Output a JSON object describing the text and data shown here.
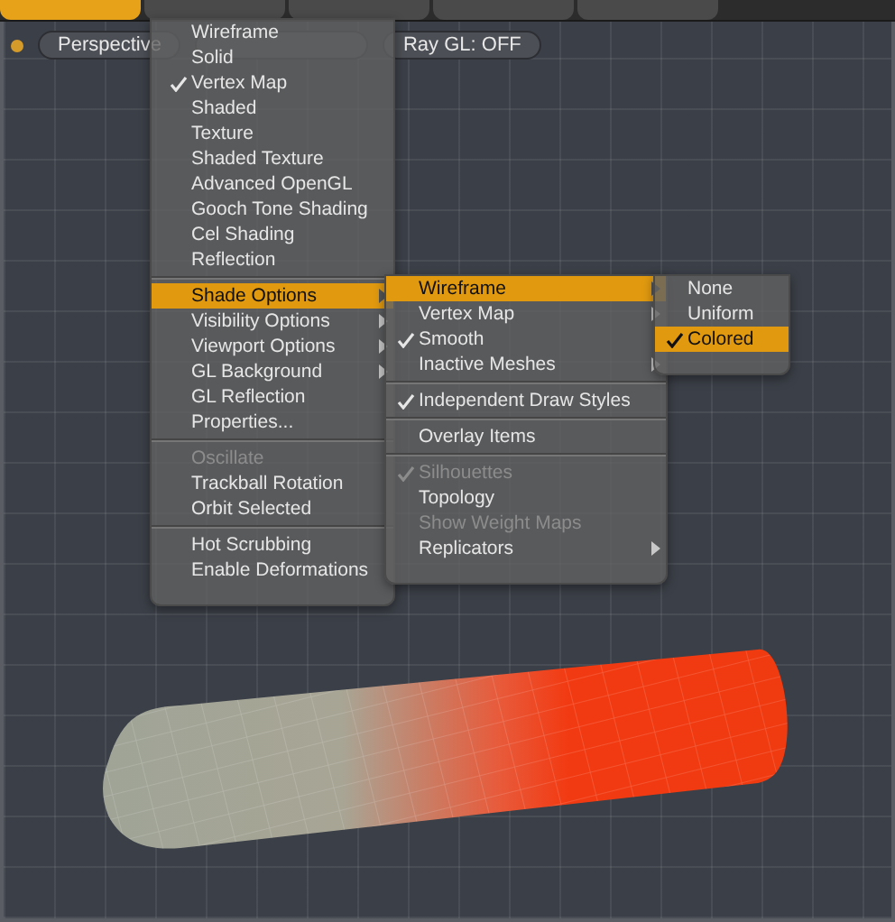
{
  "top_tabs": [
    {
      "selected": true
    },
    {
      "selected": false
    },
    {
      "selected": false
    },
    {
      "selected": false
    },
    {
      "selected": false
    }
  ],
  "viewport_bar": {
    "items": [
      {
        "label": "Perspective"
      },
      {
        "label": "Ray GL: OFF"
      }
    ]
  },
  "menus": [
    {
      "sections": [
        [
          {
            "label": "Wireframe",
            "checked": false,
            "disabled": false,
            "selected": false,
            "submenu": false
          },
          {
            "label": "Solid",
            "checked": false,
            "disabled": false,
            "selected": false,
            "submenu": false
          },
          {
            "label": "Vertex Map",
            "checked": true,
            "disabled": false,
            "selected": false,
            "submenu": false
          },
          {
            "label": "Shaded",
            "checked": false,
            "disabled": false,
            "selected": false,
            "submenu": false
          },
          {
            "label": "Texture",
            "checked": false,
            "disabled": false,
            "selected": false,
            "submenu": false
          },
          {
            "label": "Shaded Texture",
            "checked": false,
            "disabled": false,
            "selected": false,
            "submenu": false
          },
          {
            "label": "Advanced OpenGL",
            "checked": false,
            "disabled": false,
            "selected": false,
            "submenu": false
          },
          {
            "label": "Gooch Tone Shading",
            "checked": false,
            "disabled": false,
            "selected": false,
            "submenu": false
          },
          {
            "label": "Cel Shading",
            "checked": false,
            "disabled": false,
            "selected": false,
            "submenu": false
          },
          {
            "label": "Reflection",
            "checked": false,
            "disabled": false,
            "selected": false,
            "submenu": false
          }
        ],
        [
          {
            "label": "Shade Options",
            "checked": false,
            "disabled": false,
            "selected": true,
            "submenu": true
          },
          {
            "label": "Visibility Options",
            "checked": false,
            "disabled": false,
            "selected": false,
            "submenu": true
          },
          {
            "label": "Viewport Options",
            "checked": false,
            "disabled": false,
            "selected": false,
            "submenu": true
          },
          {
            "label": "GL Background",
            "checked": false,
            "disabled": false,
            "selected": false,
            "submenu": true
          },
          {
            "label": "GL Reflection",
            "checked": false,
            "disabled": false,
            "selected": false,
            "submenu": false
          },
          {
            "label": "Properties...",
            "checked": false,
            "disabled": false,
            "selected": false,
            "submenu": false
          }
        ],
        [
          {
            "label": "Oscillate",
            "checked": false,
            "disabled": true,
            "selected": false,
            "submenu": false
          },
          {
            "label": "Trackball Rotation",
            "checked": false,
            "disabled": false,
            "selected": false,
            "submenu": false
          },
          {
            "label": "Orbit Selected",
            "checked": false,
            "disabled": false,
            "selected": false,
            "submenu": false
          }
        ],
        [
          {
            "label": "Hot Scrubbing",
            "checked": false,
            "disabled": false,
            "selected": false,
            "submenu": false
          },
          {
            "label": "Enable Deformations",
            "checked": false,
            "disabled": false,
            "selected": false,
            "submenu": false
          }
        ]
      ]
    },
    {
      "sections": [
        [
          {
            "label": "Wireframe",
            "checked": false,
            "disabled": false,
            "selected": true,
            "submenu": true
          },
          {
            "label": "Vertex Map",
            "checked": false,
            "disabled": false,
            "selected": false,
            "submenu": true
          },
          {
            "label": "Smooth",
            "checked": true,
            "disabled": false,
            "selected": false,
            "submenu": false
          },
          {
            "label": "Inactive Meshes",
            "checked": false,
            "disabled": false,
            "selected": false,
            "submenu": true
          }
        ],
        [
          {
            "label": "Independent Draw Styles",
            "checked": true,
            "disabled": false,
            "selected": false,
            "submenu": false
          }
        ],
        [
          {
            "label": "Overlay Items",
            "checked": false,
            "disabled": false,
            "selected": false,
            "submenu": false
          }
        ],
        [
          {
            "label": "Silhouettes",
            "checked": true,
            "disabled": true,
            "selected": false,
            "submenu": false
          },
          {
            "label": "Topology",
            "checked": false,
            "disabled": false,
            "selected": false,
            "submenu": false
          },
          {
            "label": "Show Weight Maps",
            "checked": false,
            "disabled": true,
            "selected": false,
            "submenu": false
          },
          {
            "label": "Replicators",
            "checked": false,
            "disabled": false,
            "selected": false,
            "submenu": true
          }
        ]
      ]
    },
    {
      "sections": [
        [
          {
            "label": "None",
            "checked": false,
            "disabled": false,
            "selected": false,
            "submenu": false
          },
          {
            "label": "Uniform",
            "checked": false,
            "disabled": false,
            "selected": false,
            "submenu": false
          },
          {
            "label": "Colored",
            "checked": true,
            "disabled": false,
            "selected": true,
            "submenu": false
          }
        ]
      ]
    }
  ]
}
